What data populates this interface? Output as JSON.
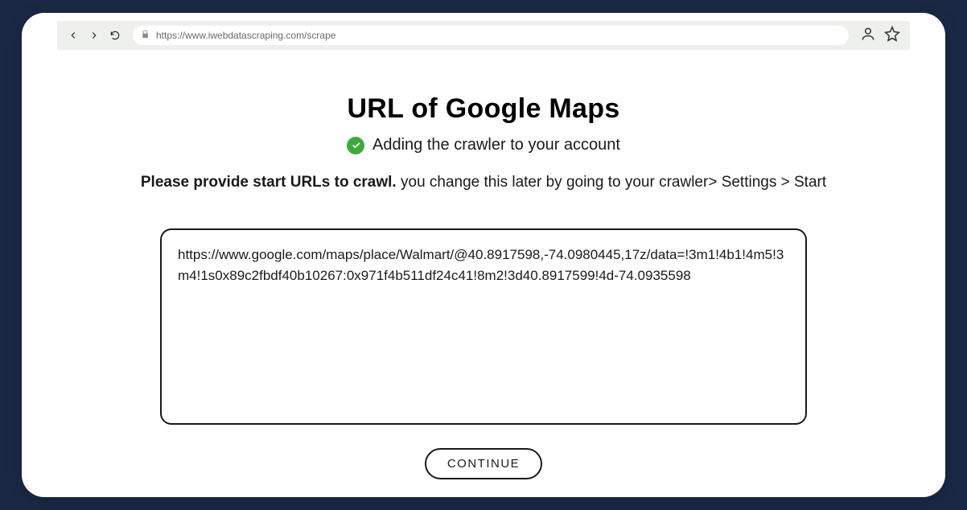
{
  "browser": {
    "url": "https://www.iwebdatascraping.com/scrape"
  },
  "page": {
    "title": "URL of Google Maps",
    "status": "Adding the crawler to your account",
    "instruction_bold": "Please provide start URLs to crawl.",
    "instruction_rest": " you change this later by going to your crawler> Settings > Start",
    "textarea_value": "https://www.google.com/maps/place/Walmart/@40.8917598,-74.0980445,17z/data=!3m1!4b1!4m5!3m4!1s0x89c2fbdf40b10267:0x971f4b511df24c41!8m2!3d40.8917599!4d-74.0935598",
    "continue_label": "CONTINUE"
  }
}
